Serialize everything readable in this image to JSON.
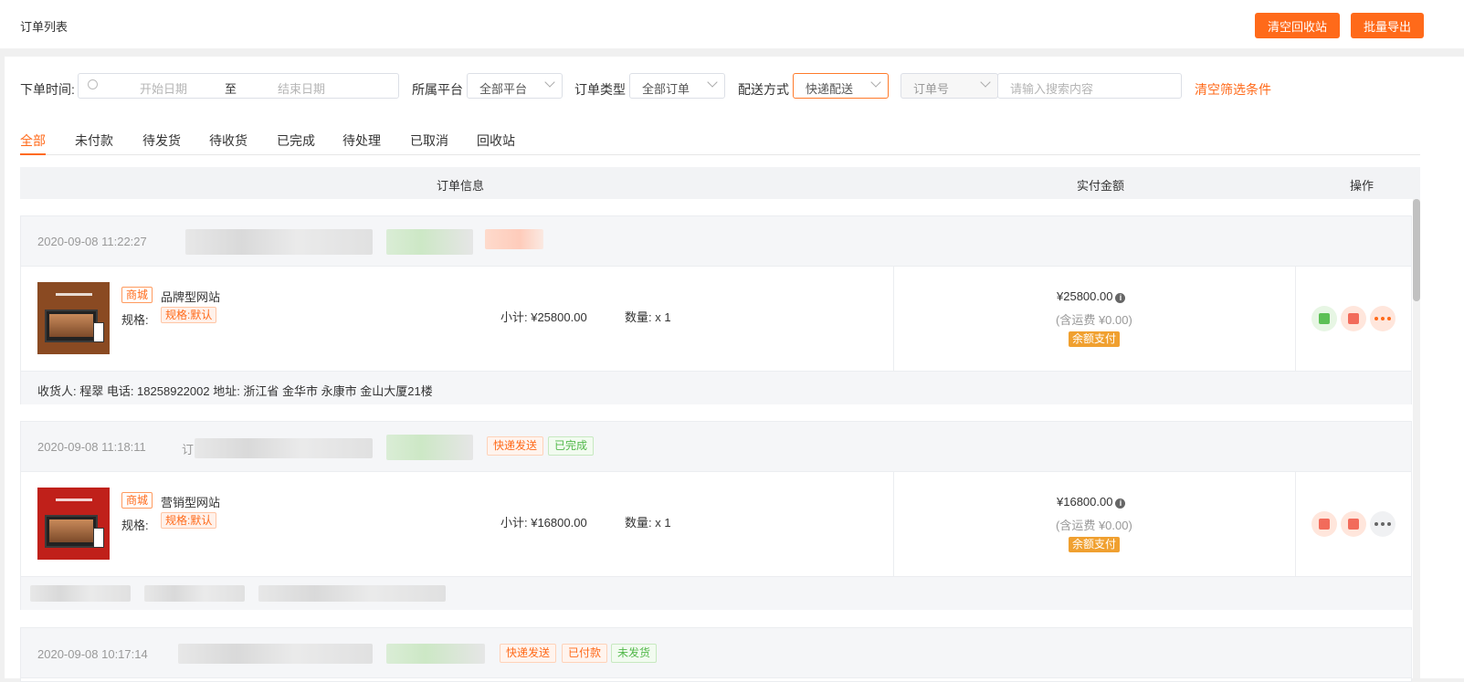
{
  "header": {
    "title": "订单列表",
    "clear_recycle_label": "清空回收站",
    "batch_export_label": "批量导出"
  },
  "filters": {
    "time_label": "下单时间:",
    "start_placeholder": "开始日期",
    "range_sep": "至",
    "end_placeholder": "结束日期",
    "platform_label": "所属平台",
    "platform_value": "全部平台",
    "order_type_label": "订单类型",
    "order_type_value": "全部订单",
    "delivery_label": "配送方式",
    "delivery_value": "快递配送",
    "search_field_value": "订单号",
    "search_placeholder": "请输入搜索内容",
    "clear_filters_label": "清空筛选条件"
  },
  "tabs": [
    "全部",
    "未付款",
    "待发货",
    "待收货",
    "已完成",
    "待处理",
    "已取消",
    "回收站"
  ],
  "active_tab": "全部",
  "table_header": {
    "info": "订单信息",
    "paid": "实付金额",
    "actions": "操作"
  },
  "orders": [
    {
      "date": "2020-09-08 11:22:27",
      "mall_tag": "商城",
      "product_name": "品牌型网站",
      "spec_label": "规格:",
      "spec_value": "规格:默认",
      "subtotal": "小计: ¥25800.00",
      "quantity": "数量: x 1",
      "price": "¥25800.00",
      "shipping": "(含运费 ¥0.00)",
      "pay_method": "余额支付",
      "address": "收货人: 程翠 电话: 18258922002 地址: 浙江省 金华市 永康市 金山大厦21楼"
    },
    {
      "date": "2020-09-08 11:18:11",
      "order_prefix": "订",
      "tags": [
        "快递发送",
        "已完成"
      ],
      "mall_tag": "商城",
      "product_name": "营销型网站",
      "spec_label": "规格:",
      "spec_value": "规格:默认",
      "subtotal": "小计: ¥16800.00",
      "quantity": "数量: x 1",
      "price": "¥16800.00",
      "shipping": "(含运费 ¥0.00)",
      "pay_method": "余额支付"
    },
    {
      "date": "2020-09-08 10:17:14",
      "tags": [
        "快递发送",
        "已付款",
        "未发货"
      ]
    }
  ],
  "colors": {
    "accent": "#ff6a1a",
    "success": "#52b84a",
    "pay_badge": "#f0a030"
  },
  "icons": {
    "clock": "clock-icon",
    "chevron": "chevron-down-icon",
    "info": "info-icon",
    "ship": "ship-icon",
    "print": "print-icon",
    "message": "message-icon",
    "more": "more-icon"
  }
}
